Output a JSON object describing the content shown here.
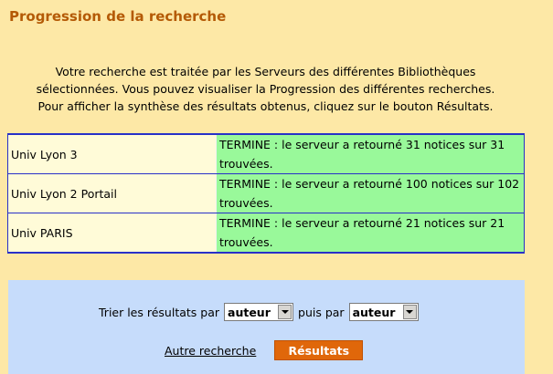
{
  "page": {
    "title": "Progression de la recherche",
    "intro": [
      "Votre recherche est traitée par les Serveurs des différentes Bibliothèques",
      "sélectionnées. Vous pouvez visualiser la Progression des différentes recherches.",
      "Pour afficher la synthèse des résultats obtenus, cliquez sur le bouton Résultats."
    ]
  },
  "results": [
    {
      "library": "Univ Lyon 3",
      "status": "TERMINE : le serveur a retourné 31 notices sur 31 trouvées."
    },
    {
      "library": "Univ Lyon 2 Portail",
      "status": "TERMINE : le serveur a retourné 100 notices sur 102 trouvées."
    },
    {
      "library": "Univ PARIS",
      "status": "TERMINE : le serveur a retourné 21 notices sur 21 trouvées."
    }
  ],
  "sort": {
    "label_first": "Trier les résultats par",
    "first_value": "auteur",
    "label_second": "puis par",
    "second_value": "auteur"
  },
  "actions": {
    "new_search": "Autre recherche",
    "results_button": "Résultats"
  },
  "colors": {
    "background": "#fde8a6",
    "title": "#b45a06",
    "status_cell": "#99f99a",
    "library_cell": "#fffbd8",
    "panel": "#c6dcfb",
    "button": "#e0670a",
    "table_border": "#2830c8"
  }
}
